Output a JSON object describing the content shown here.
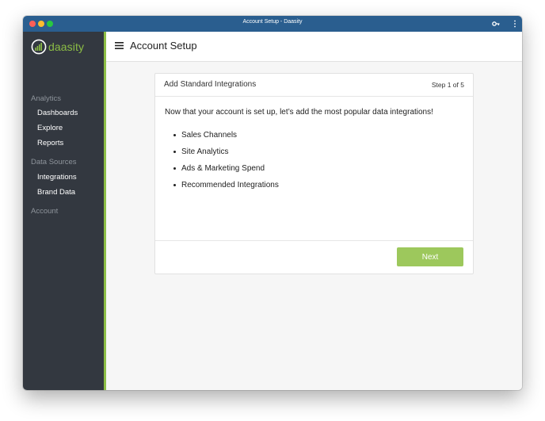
{
  "window": {
    "title": "Account Setup - Daasity"
  },
  "brand": {
    "logo_text": "daasity",
    "accent_color": "#8cbd45",
    "sidebar_color": "#333840",
    "titlebar_color": "#2a5e8f"
  },
  "sidebar": {
    "groups": [
      {
        "label": "Analytics",
        "items": [
          "Dashboards",
          "Explore",
          "Reports"
        ]
      },
      {
        "label": "Data Sources",
        "items": [
          "Integrations",
          "Brand Data"
        ]
      },
      {
        "label": "Account",
        "items": []
      }
    ]
  },
  "header": {
    "menu_icon": "hamburger-icon",
    "title": "Account Setup"
  },
  "card": {
    "title": "Add Standard Integrations",
    "step": "Step 1 of 5",
    "intro": "Now that your account is set up, let’s add the most popular data integrations!",
    "bullets": [
      "Sales Channels",
      "Site Analytics",
      "Ads & Marketing Spend",
      "Recommended Integrations"
    ],
    "next_label": "Next",
    "next_color": "#9dc85c"
  }
}
